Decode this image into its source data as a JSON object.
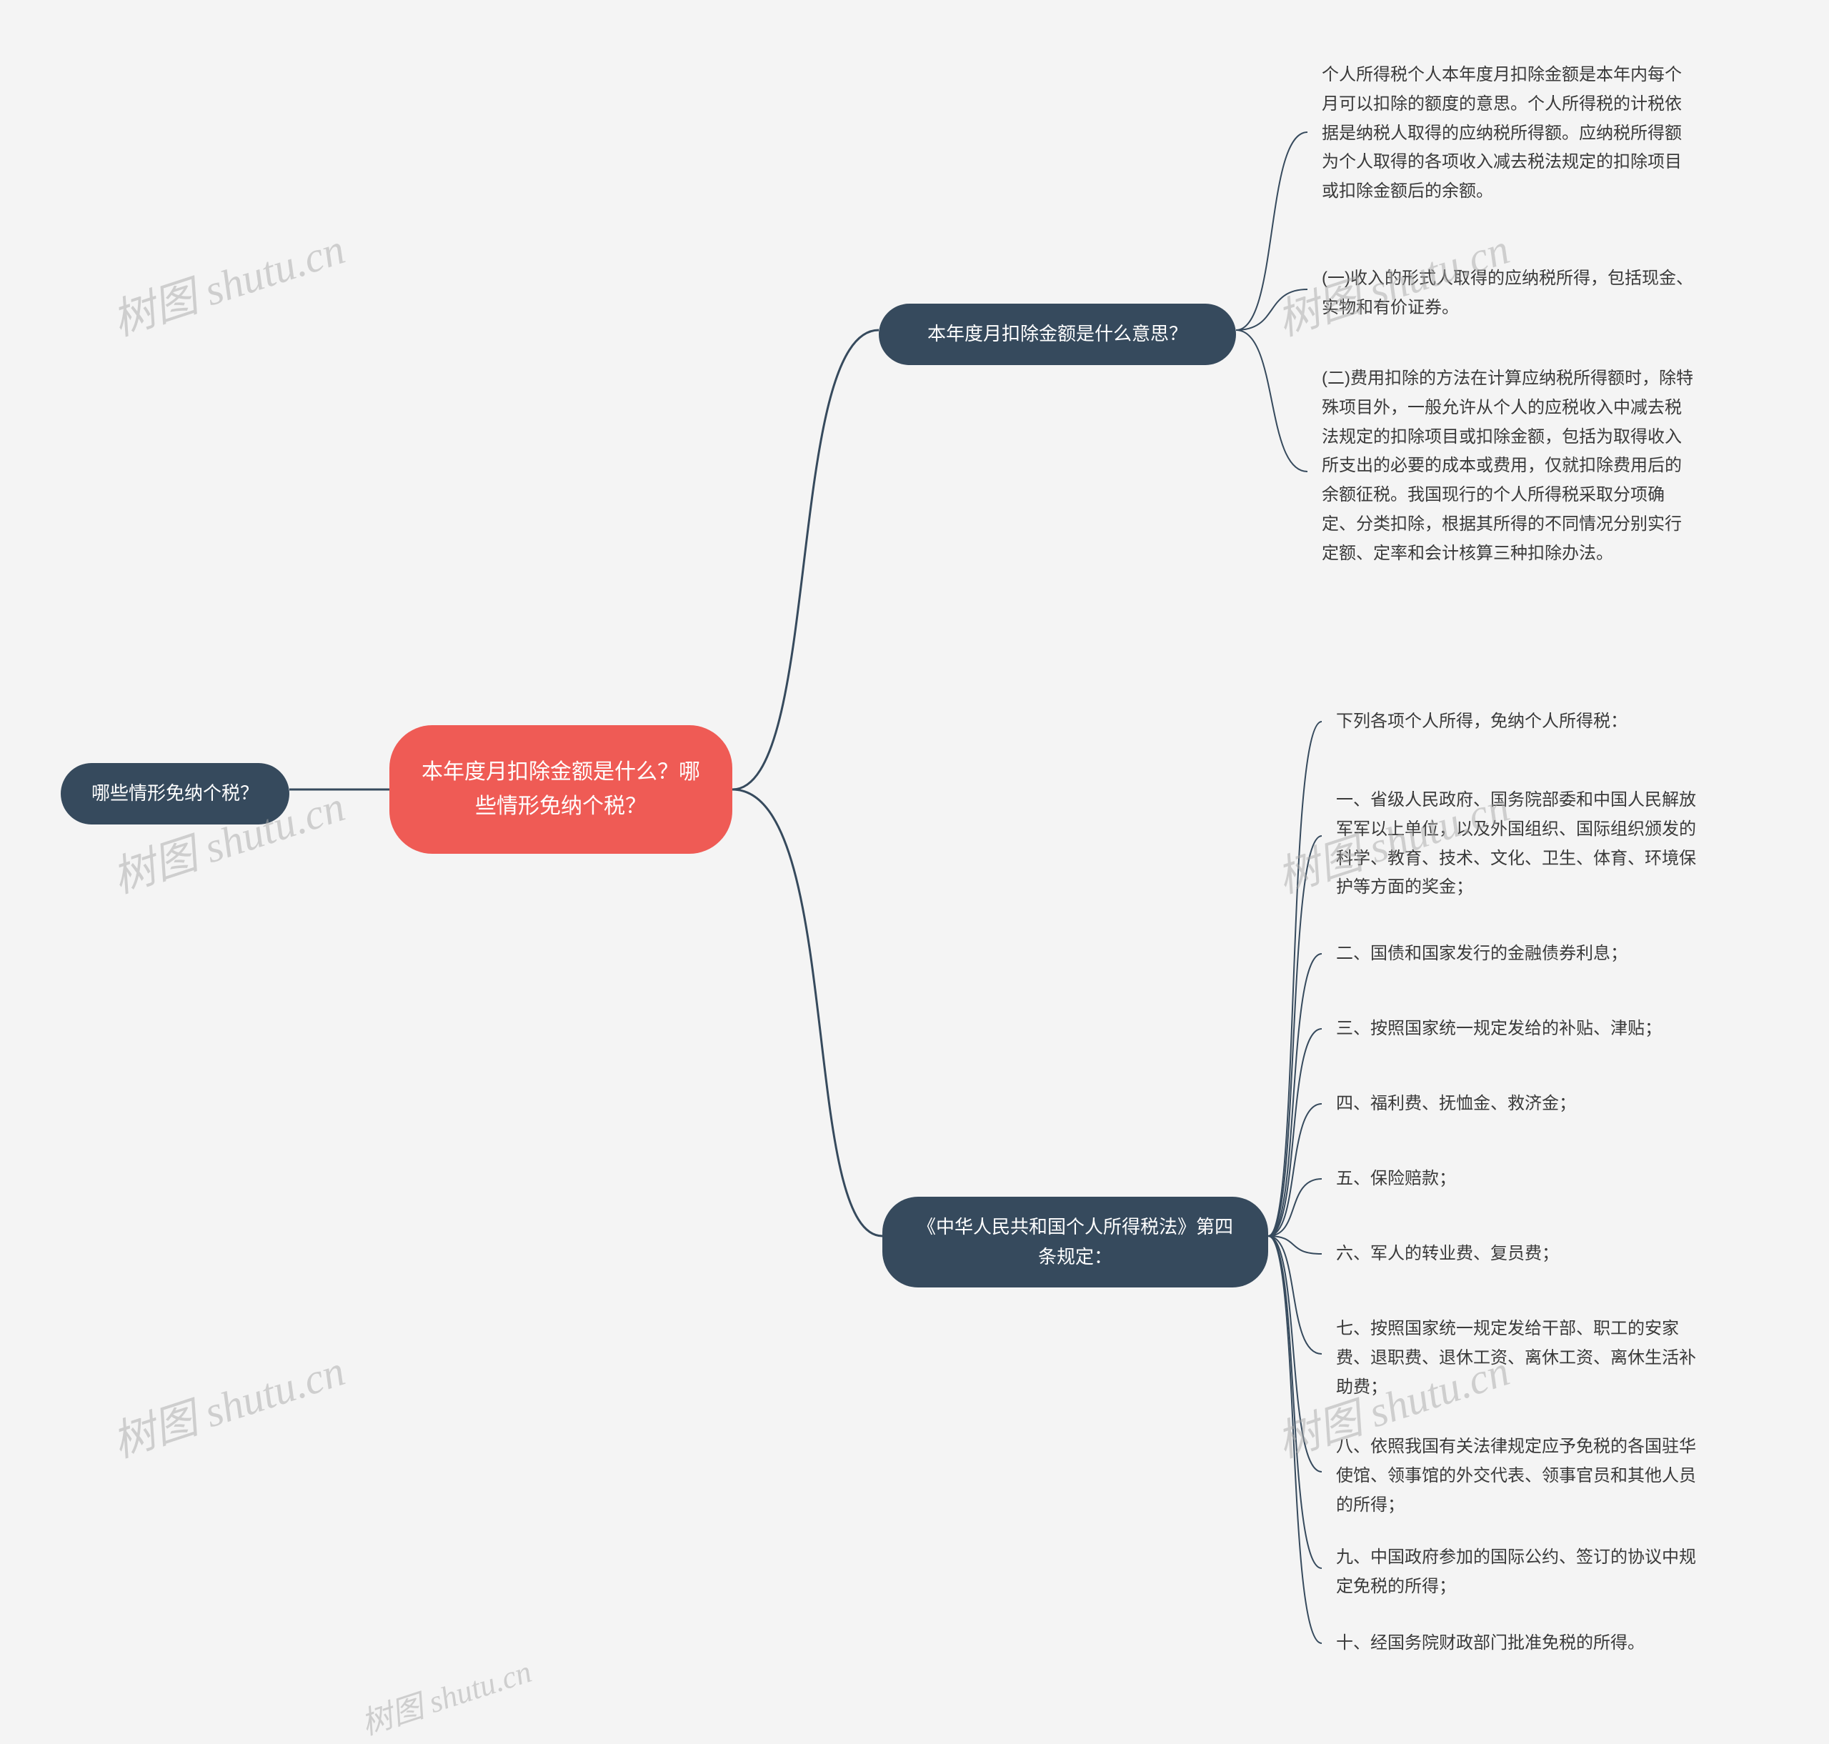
{
  "root": {
    "title": "本年度月扣除金额是什么？哪些情形免纳个税？"
  },
  "left": {
    "label": "哪些情形免纳个税？"
  },
  "branch1": {
    "label": "本年度月扣除金额是什么意思？",
    "leaves": [
      "个人所得税个人本年度月扣除金额是本年内每个月可以扣除的额度的意思。个人所得税的计税依据是纳税人取得的应纳税所得额。应纳税所得额为个人取得的各项收入减去税法规定的扣除项目或扣除金额后的余额。",
      "(一)收入的形式人取得的应纳税所得，包括现金、实物和有价证券。",
      "(二)费用扣除的方法在计算应纳税所得额时，除特殊项目外，一般允许从个人的应税收入中减去税法规定的扣除项目或扣除金额，包括为取得收入所支出的必要的成本或费用，仅就扣除费用后的余额征税。我国现行的个人所得税采取分项确定、分类扣除，根据其所得的不同情况分别实行定额、定率和会计核算三种扣除办法。"
    ]
  },
  "branch2": {
    "label": "《中华人民共和国个人所得税法》第四条规定：",
    "leaves": [
      "下列各项个人所得，免纳个人所得税：",
      "一、省级人民政府、国务院部委和中国人民解放军军以上单位，以及外国组织、国际组织颁发的科学、教育、技术、文化、卫生、体育、环境保护等方面的奖金；",
      "二、国债和国家发行的金融债券利息；",
      "三、按照国家统一规定发给的补贴、津贴；",
      "四、福利费、抚恤金、救济金；",
      "五、保险赔款；",
      "六、军人的转业费、复员费；",
      "七、按照国家统一规定发给干部、职工的安家费、退职费、退休工资、离休工资、离休生活补助费；",
      "八、依照我国有关法律规定应予免税的各国驻华使馆、领事馆的外交代表、领事官员和其他人员的所得；",
      "九、中国政府参加的国际公约、签订的协议中规定免税的所得；",
      "十、经国务院财政部门批准免税的所得。"
    ]
  },
  "watermark": "树图 shutu.cn"
}
